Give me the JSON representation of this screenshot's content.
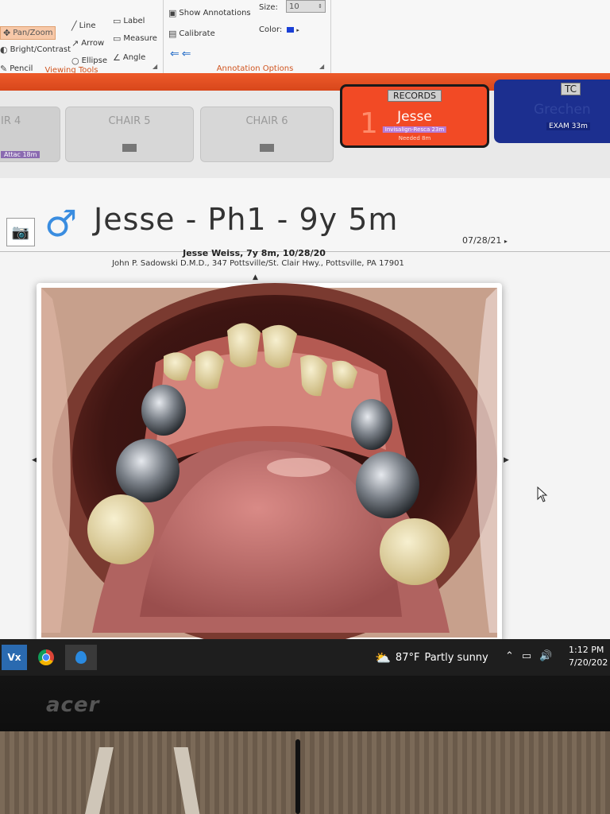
{
  "ribbon": {
    "viewing_tools": {
      "pan_zoom": "Pan/Zoom",
      "bright_contrast": "Bright/Contrast",
      "pencil": "Pencil",
      "line": "Line",
      "arrow": "Arrow",
      "ellipse": "Ellipse",
      "label": "Label",
      "measure": "Measure",
      "angle": "Angle",
      "group_label": "Viewing Tools"
    },
    "annotation_options": {
      "show_annotations": "Show Annotations",
      "calibrate": "Calibrate",
      "size_label": "Size:",
      "size_value": "10",
      "color_label": "Color:",
      "color_value": "#1a3fd6",
      "group_label": "Annotation Options"
    }
  },
  "chairs": {
    "chair4": {
      "name": "IR 4",
      "sub": "Attac 18m"
    },
    "chair5": {
      "name": "CHAIR 5"
    },
    "chair6": {
      "name": "CHAIR 6"
    },
    "active": {
      "room": "RECORDS",
      "number": "1",
      "patient": "Jesse",
      "tag": "Invisalign-Resca 23m",
      "note": "Needed 8m"
    },
    "tc": {
      "room": "TC",
      "patient": "Grechen",
      "status": "EXAM 33m"
    }
  },
  "patient": {
    "title": "Jesse - Ph1 - 9y 5m",
    "caption": "Jesse Weiss, 7y 8m, 10/28/20",
    "practice": "John P. Sadowski D.M.D., 347 Pottsville/St. Clair Hwy., Pottsville, PA 17901",
    "other_date": "07/28/21"
  },
  "taskbar": {
    "vx_label": "Vx",
    "temperature": "87°F",
    "weather": "Partly sunny",
    "time": "1:12 PM",
    "date": "7/20/202"
  },
  "monitor": {
    "brand": "acer"
  }
}
